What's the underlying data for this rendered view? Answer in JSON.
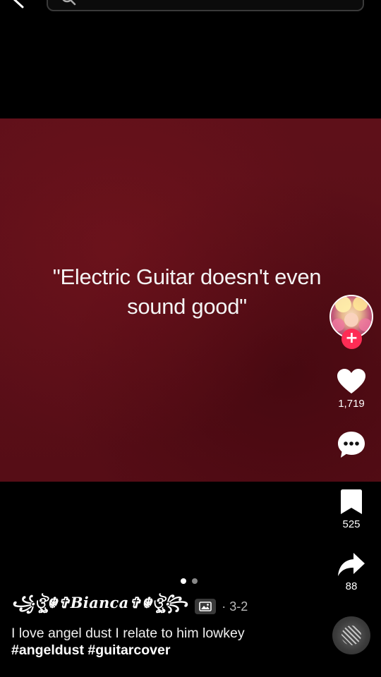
{
  "header": {
    "search_icon": "search-icon",
    "back_icon": "chevron-left-icon"
  },
  "post": {
    "overlay_text_line1": "\"Electric Guitar doesn't even",
    "overlay_text_line2": "sound good\"",
    "media_color": "#5a0f18"
  },
  "rail": {
    "follow_label": "+",
    "likes": "1,719",
    "saves": "525",
    "shares": "88"
  },
  "author": {
    "name": "꧁ঔৣ☬✞Bianca✞☬ঔৣ꧂",
    "date": "· 3-2"
  },
  "caption": {
    "text": "I love angel dust I relate to him lowkey",
    "hashtag1": "#angeldust",
    "hashtag2": "#guitarcover"
  },
  "colors": {
    "accent": "#fe2c55",
    "background": "#000000"
  }
}
